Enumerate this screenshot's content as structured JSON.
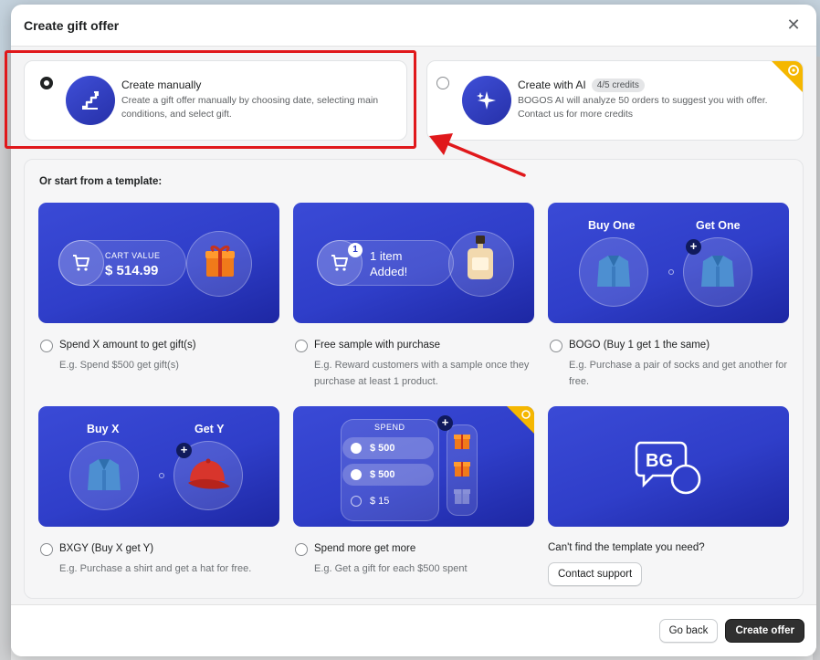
{
  "modal": {
    "title": "Create gift offer",
    "close_glyph": "✕"
  },
  "options": {
    "manual": {
      "title": "Create manually",
      "description": "Create a gift offer manually by choosing date, selecting main conditions, and select gift.",
      "selected": true,
      "icon": "stairs-icon"
    },
    "ai": {
      "title": "Create with AI",
      "credits": "4/5 credits",
      "description": "BOGOS AI will analyze 50 orders to suggest you with offer. Contact us for more credits",
      "selected": false,
      "icon": "sparkle-icon"
    }
  },
  "templates": {
    "heading": "Or start from a template:",
    "items": [
      {
        "title": "Spend X amount to get gift(s)",
        "desc": "E.g. Spend $500 get gift(s)",
        "art": {
          "label": "CART VALUE",
          "value": "$ 514.99"
        }
      },
      {
        "title": "Free sample with purchase",
        "desc": "E.g. Reward customers with a sample once they purchase at least 1 product.",
        "art": {
          "badge": "1",
          "line1": "1 item",
          "line2": "Added!"
        }
      },
      {
        "title": "BOGO (Buy 1 get 1 the same)",
        "desc": "E.g. Purchase a pair of socks and get another for free.",
        "art": {
          "left": "Buy One",
          "right": "Get One"
        }
      },
      {
        "title": "BXGY (Buy X get Y)",
        "desc": "E.g. Purchase a shirt and get a hat for free.",
        "art": {
          "left": "Buy X",
          "right": "Get Y"
        }
      },
      {
        "title": "Spend more get more",
        "desc": "E.g. Get a gift for each $500 spent",
        "art": {
          "label": "SPEND",
          "rows": [
            "$ 500",
            "$ 500",
            "$ 15"
          ]
        }
      }
    ],
    "support": {
      "question": "Can't find the template you need?",
      "button": "Contact support"
    }
  },
  "footer": {
    "back": "Go back",
    "create": "Create offer"
  },
  "colors": {
    "accent_blue": "#2f3ec9",
    "highlight_red": "#e0181b",
    "primary_button": "#303030",
    "ribbon": "#f5b700"
  }
}
